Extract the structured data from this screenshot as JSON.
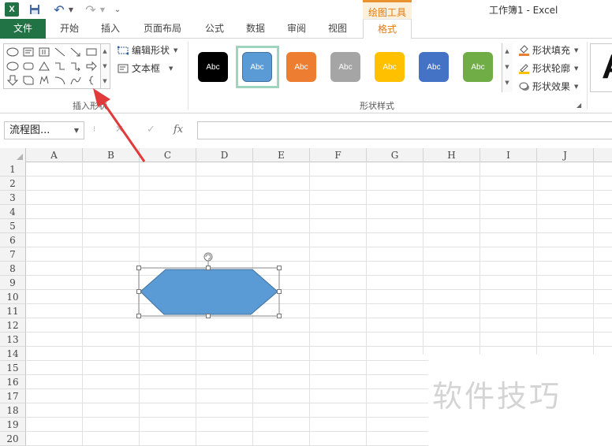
{
  "titlebar": {
    "app_icon": "excel-logo-icon",
    "app_icon_letter": "X",
    "context_tab_group": "绘图工具",
    "window_title": "工作簿1 - Excel"
  },
  "tabs": [
    {
      "label": "文件"
    },
    {
      "label": "开始"
    },
    {
      "label": "插入"
    },
    {
      "label": "页面布局"
    },
    {
      "label": "公式"
    },
    {
      "label": "数据"
    },
    {
      "label": "审阅"
    },
    {
      "label": "视图"
    },
    {
      "label": "格式",
      "active": true
    }
  ],
  "ribbon": {
    "insert_shapes": {
      "edit_shape": "编辑形状",
      "text_box": "文本框",
      "group_label": "插入形状"
    },
    "shape_styles": {
      "group_label": "形状样式",
      "presets": [
        {
          "label": "Abc",
          "color": "#000000"
        },
        {
          "label": "Abc",
          "color": "#5b9bd5",
          "selected": true
        },
        {
          "label": "Abc",
          "color": "#ed7d31"
        },
        {
          "label": "Abc",
          "color": "#a5a5a5"
        },
        {
          "label": "Abc",
          "color": "#ffc000"
        },
        {
          "label": "Abc",
          "color": "#4472c4"
        },
        {
          "label": "Abc",
          "color": "#70ad47"
        }
      ],
      "fill": "形状填充",
      "outline": "形状轮廓",
      "effects": "形状效果"
    },
    "wordart_preview": "A"
  },
  "formula_bar": {
    "name_box": "流程图...",
    "fx": "fx",
    "value": ""
  },
  "sheet": {
    "columns": [
      "A",
      "B",
      "C",
      "D",
      "E",
      "F",
      "G",
      "H",
      "I",
      "J"
    ],
    "rows": [
      "1",
      "2",
      "3",
      "4",
      "5",
      "6",
      "7",
      "8",
      "9",
      "10",
      "11",
      "12",
      "13",
      "14",
      "15",
      "16",
      "17",
      "18",
      "19",
      "20"
    ]
  },
  "shape": {
    "fill_color": "#5b9bd5",
    "outline_color": "#41719c"
  },
  "watermark": "软件技巧",
  "colors": {
    "accent_green": "#217346",
    "context_orange": "#e07a10",
    "annotation_red": "#e03a3a"
  }
}
